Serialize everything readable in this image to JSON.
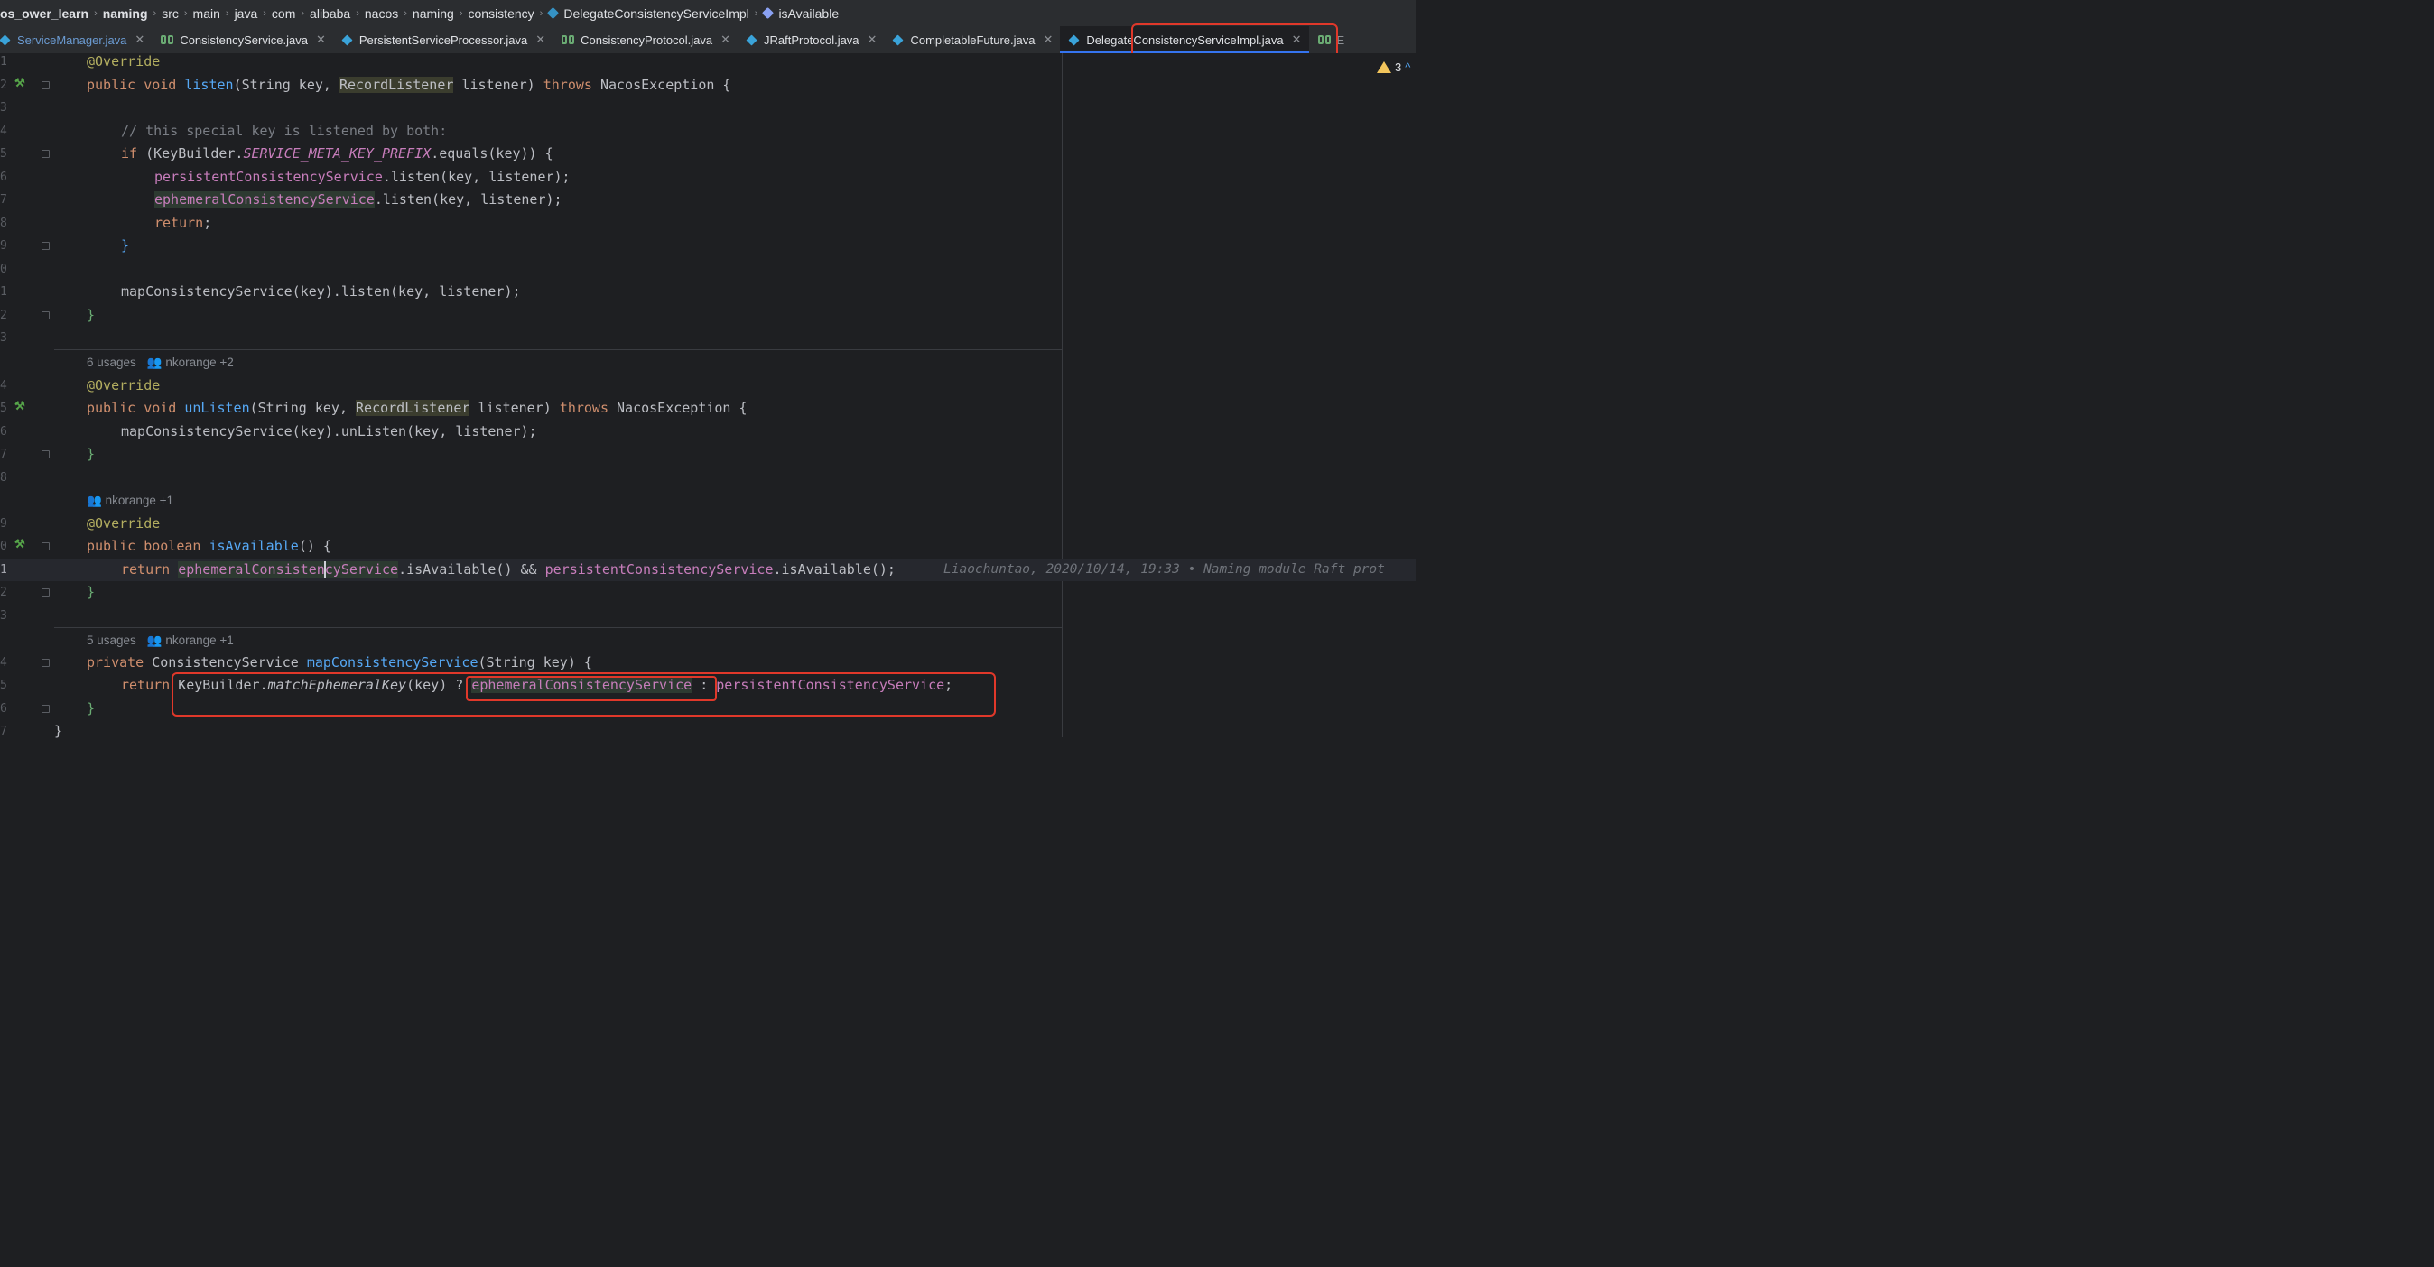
{
  "breadcrumb": {
    "items": [
      "os_ower_learn",
      "naming",
      "src",
      "main",
      "java",
      "com",
      "alibaba",
      "nacos",
      "naming",
      "consistency",
      "DelegateConsistencyServiceImpl",
      "isAvailable"
    ]
  },
  "tabs": [
    {
      "label": "ServiceManager.java",
      "icon": "class-icon"
    },
    {
      "label": "ConsistencyService.java",
      "icon": "interface-icon"
    },
    {
      "label": "PersistentServiceProcessor.java",
      "icon": "class-icon"
    },
    {
      "label": "ConsistencyProtocol.java",
      "icon": "interface-icon"
    },
    {
      "label": "JRaftProtocol.java",
      "icon": "class-icon"
    },
    {
      "label": "CompletableFuture.java",
      "icon": "class-icon"
    },
    {
      "label": "DelegateConsistencyServiceImpl.java",
      "icon": "class-icon",
      "active": true
    },
    {
      "label": "E",
      "icon": "interface-icon"
    }
  ],
  "inspections": {
    "warnings": "3"
  },
  "lines": {
    "n1": "1",
    "n2": "2",
    "n3": "3",
    "n4": "4",
    "n5": "5",
    "n6": "6",
    "n7": "7",
    "n8": "8",
    "n9": "9",
    "n10": "0",
    "n11": "1",
    "n12": "2",
    "n13": "3",
    "n14": "4",
    "n15": "5",
    "n16": "6",
    "n17": "7",
    "n18": "8",
    "n19": "9",
    "n20": "0",
    "n21": "1",
    "n22": "2",
    "n23": "3",
    "n24": "4",
    "n25": "5",
    "n26": "6",
    "n27": "7"
  },
  "code": {
    "override": "@Override",
    "public": "public",
    "void": "void",
    "boolean": "boolean",
    "private": "private",
    "listen": "listen",
    "unListen": "unListen",
    "isAvailable": "isAvailable",
    "mapConsistencyService": "mapConsistencyService",
    "string_key": "(String key, ",
    "recordListener": "RecordListener",
    "listener_paren": " listener) ",
    "throws": "throws",
    "nacosException": " NacosException {",
    "comment": "// this special key is listened by both:",
    "if": "if",
    "if_open": " (KeyBuilder.",
    "prefix": "SERVICE_META_KEY_PREFIX",
    "equals": ".equals(key)) {",
    "persistentCS": "persistentConsistencyService",
    "ephemeralCS": "ephemeralConsistencyService",
    "listen_call": ".listen(key, listener);",
    "return": "return",
    "semicolon": ";",
    "close_brace": "}",
    "map_listen": "mapConsistencyService(key).listen(key, listener);",
    "map_unlisten": "mapConsistencyService(key).unListen(key, listener);",
    "isAvailable_sig": "() {",
    "ephemeral_a": "ephemeralConsisten",
    "ephemeral_b": "cyService",
    "isAvailable_call": ".isAvailable() && ",
    "isAvailable_end": ".isAvailable();",
    "consistencyService_type": " ConsistencyService ",
    "string_key_sig": "(String key) {",
    "keybuilder": "KeyBuilder.",
    "matchEphemeralKey": "matchEphemeralKey",
    "key_q": "(key) ? ",
    "colon": " : ",
    "last_brace": "}"
  },
  "meta": {
    "usages6": "6 usages",
    "people1": "nkorange +2",
    "people2": "nkorange +1",
    "usages5": "5 usages",
    "people3": "nkorange +1"
  },
  "blame": "Liaochuntao, 2020/10/14, 19:33 • Naming module Raft prot"
}
